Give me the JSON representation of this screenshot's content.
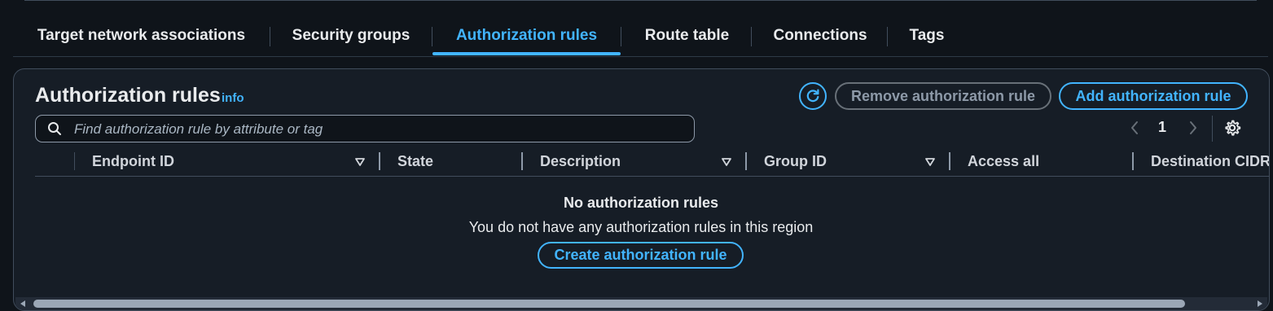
{
  "tabs": [
    {
      "label": "Target network associations"
    },
    {
      "label": "Security groups"
    },
    {
      "label": "Authorization rules",
      "active": true
    },
    {
      "label": "Route table"
    },
    {
      "label": "Connections"
    },
    {
      "label": "Tags"
    }
  ],
  "panel": {
    "title": "Authorization rules",
    "info": "info",
    "refresh_icon": "refresh-icon",
    "remove_button": "Remove authorization rule",
    "add_button": "Add authorization rule"
  },
  "search": {
    "placeholder": "Find authorization rule by attribute or tag",
    "value": ""
  },
  "pagination": {
    "page": "1"
  },
  "table": {
    "columns": [
      "Endpoint ID",
      "State",
      "Description",
      "Group ID",
      "Access all",
      "Destination CIDR"
    ],
    "rows": []
  },
  "empty_state": {
    "title": "No authorization rules",
    "message": "You do not have any authorization rules in this region",
    "button": "Create authorization rule"
  },
  "colors": {
    "background": "#0f141a",
    "panel": "#161d26",
    "accent": "#42b4ff",
    "border": "#414d5c",
    "text": "#e9ebed",
    "disabled": "#8d99a8"
  }
}
